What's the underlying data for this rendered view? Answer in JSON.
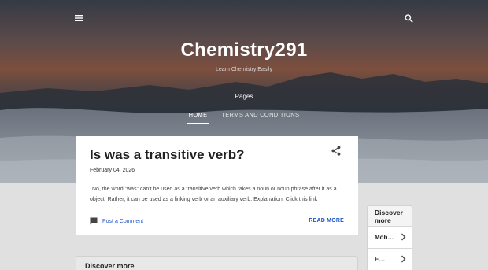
{
  "header": {
    "title": "Chemistry291",
    "description": "Learn Chemistry Easily",
    "pages_label": "Pages",
    "tabs": [
      {
        "label": "HOME",
        "active": true
      },
      {
        "label": "TERMS AND CONDITIONS",
        "active": false
      }
    ],
    "icons": {
      "menu": "hamburger-menu-icon",
      "search": "search-icon"
    }
  },
  "post": {
    "title": "Is was a transitive verb?",
    "date": "February 04, 2026",
    "snippet": "No, the word \"was\" can't be used as a transitive verb which takes a noun or noun phrase after it as a object. Rather, it can be used as a linking verb or an auxiliary verb. Explanation: Click this link",
    "comment_label": "Post a Comment",
    "read_more_label": "READ MORE",
    "icons": {
      "share": "share-icon",
      "comment": "comment-icon"
    }
  },
  "discover_bottom": {
    "label": "Discover more"
  },
  "discover_side": {
    "label": "Discover more",
    "items": [
      {
        "label": "Mob…"
      },
      {
        "label": "E…"
      }
    ]
  },
  "colors": {
    "link": "#1e55c8",
    "card_bg": "#ffffff",
    "page_bg": "#e0e0e0"
  }
}
